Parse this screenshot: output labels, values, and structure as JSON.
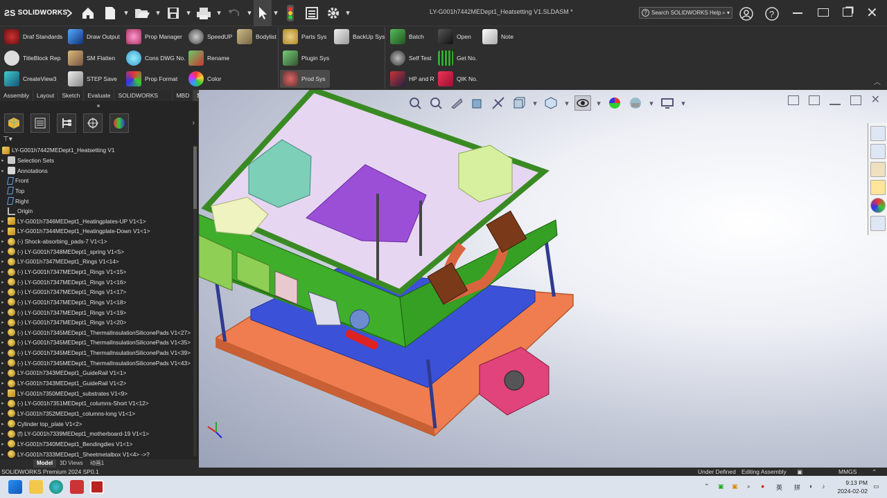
{
  "app": {
    "brand": "SOLIDWORKS",
    "brand_mark": "ƧS"
  },
  "document_title": "LY-G001h7442MEDept1_Heatsetting V1.SLDASM *",
  "search": {
    "label": "Search SOLIDWORKS Help"
  },
  "command_manager": {
    "col1": [
      "Draf Standards",
      "TitleBlock Rep",
      "CreateView3"
    ],
    "col2": [
      "Draw Output",
      "SM Flatten",
      "STEP Save"
    ],
    "col3": [
      "Prop Manager",
      "Cons DWG No.",
      "Prop Format"
    ],
    "col4": [
      "SpeedUP",
      "Rename",
      "Color"
    ],
    "col5": [
      "Bodylist"
    ],
    "col6": [
      "Parts Sys",
      "Plugin Sys",
      "Prod Sys"
    ],
    "col7": [
      "BackUp Sys"
    ],
    "col8": [
      "Batch",
      "Self Test",
      "HP and R"
    ],
    "col9": [
      "Open",
      "Get No.",
      "QIK No."
    ],
    "col10": [
      "Note"
    ]
  },
  "tabs": [
    "Assembly",
    "Layout",
    "Sketch",
    "Evaluate",
    "SOLIDWORKS Add-Ins",
    "MBD",
    "SWTDO"
  ],
  "active_tab": "SWTDO",
  "tree": {
    "root": "LY-G001h7442MEDept1_Heatsetting V1",
    "items": [
      {
        "label": "Selection Sets",
        "icon": "folder",
        "arrow": "▸"
      },
      {
        "label": "Annotations",
        "icon": "note",
        "arrow": "▸"
      },
      {
        "label": "Front",
        "icon": "plane",
        "arrow": ""
      },
      {
        "label": "Top",
        "icon": "plane",
        "arrow": ""
      },
      {
        "label": "Right",
        "icon": "plane",
        "arrow": ""
      },
      {
        "label": "Origin",
        "icon": "origin",
        "arrow": ""
      },
      {
        "label": "LY-G001h7346MEDept1_Heatingplates-UP V1<1>",
        "icon": "asm",
        "arrow": "▸"
      },
      {
        "label": "LY-G001h7344MEDept1_Heatingplate-Down V1<1>",
        "icon": "asm",
        "arrow": "▸"
      },
      {
        "label": "(-) Shock-absorbing_pads-7 V1<1>",
        "icon": "part",
        "arrow": "▸"
      },
      {
        "label": "(-) LY-G001h7348MEDept1_spring V1<5>",
        "icon": "part",
        "arrow": "▸"
      },
      {
        "label": "LY-G001h7347MEDept1_Rings V1<14>",
        "icon": "part",
        "arrow": "▸"
      },
      {
        "label": "(-) LY-G001h7347MEDept1_Rings V1<15>",
        "icon": "part",
        "arrow": "▸"
      },
      {
        "label": "(-) LY-G001h7347MEDept1_Rings V1<16>",
        "icon": "part",
        "arrow": "▸"
      },
      {
        "label": "(-) LY-G001h7347MEDept1_Rings V1<17>",
        "icon": "part",
        "arrow": "▸"
      },
      {
        "label": "(-) LY-G001h7347MEDept1_Rings V1<18>",
        "icon": "part",
        "arrow": "▸"
      },
      {
        "label": "(-) LY-G001h7347MEDept1_Rings V1<19>",
        "icon": "part",
        "arrow": "▸"
      },
      {
        "label": "(-) LY-G001h7347MEDept1_Rings V1<20>",
        "icon": "part",
        "arrow": "▸"
      },
      {
        "label": "(-) LY-G001h7345MEDept1_ThermalInsulationSiliconePads V1<27>",
        "icon": "part",
        "arrow": "▸"
      },
      {
        "label": "(-) LY-G001h7345MEDept1_ThermalInsulationSiliconePads V1<35>",
        "icon": "part",
        "arrow": "▸"
      },
      {
        "label": "(-) LY-G001h7345MEDept1_ThermalInsulationSiliconePads V1<39>",
        "icon": "part",
        "arrow": "▸"
      },
      {
        "label": "(-) LY-G001h7345MEDept1_ThermalInsulationSiliconePads V1<43>",
        "icon": "part",
        "arrow": "▸"
      },
      {
        "label": "LY-G001h7343MEDept1_GuideRail V1<1>",
        "icon": "part",
        "arrow": "▸"
      },
      {
        "label": "LY-G001h7343MEDept1_GuideRail V1<2>",
        "icon": "part",
        "arrow": "▸"
      },
      {
        "label": "LY-G001h7350MEDept1_substrates V1<9>",
        "icon": "asm",
        "arrow": "▸"
      },
      {
        "label": "(-) LY-G001h7351MEDept1_columns-Short V1<12>",
        "icon": "part",
        "arrow": "▸"
      },
      {
        "label": "LY-G001h7352MEDept1_columns-long V1<1>",
        "icon": "part",
        "arrow": "▸"
      },
      {
        "label": "Cylinder top_plate V1<2>",
        "icon": "part",
        "arrow": "▸"
      },
      {
        "label": "(f) LY-G001h7339MEDept1_motherboard-19 V1<1>",
        "icon": "part",
        "arrow": "▸"
      },
      {
        "label": "LY-G001h7340MEDept1_Bendingdies V1<1>",
        "icon": "part",
        "arrow": "▸"
      },
      {
        "label": "LY-G001h7333MEDept1_Sheetmetalbox V1<4> ->?",
        "icon": "part",
        "arrow": "▸"
      }
    ]
  },
  "bottom_tabs": [
    "Model",
    "3D Views",
    "动画1"
  ],
  "status": {
    "product": "SOLIDWORKS Premium 2024 SP0.1",
    "state": "Under Defined",
    "mode": "Editing Assembly",
    "units": "MMGS"
  },
  "taskbar": {
    "time": "9:13 PM",
    "date": "2024-02-02",
    "ime1": "英",
    "ime2": "拼"
  },
  "colors": {
    "accent": "#2b2b2b",
    "box_green": "#3fae2b",
    "purple_plate": "#9b4fd6",
    "orange_base": "#ef7d4f",
    "blue_plate": "#3b52d8"
  }
}
